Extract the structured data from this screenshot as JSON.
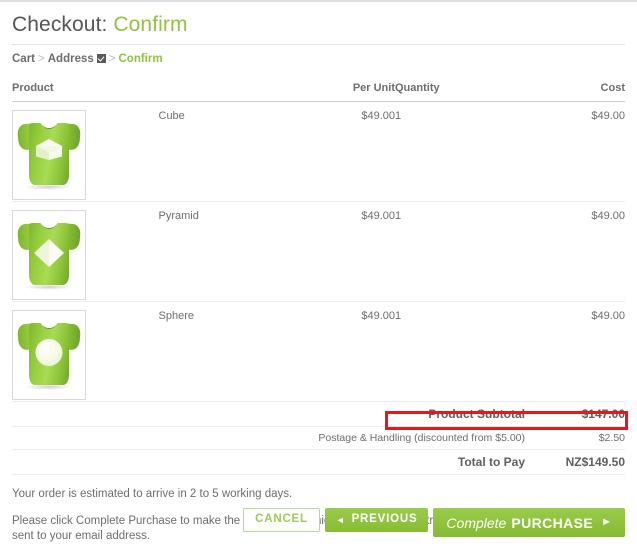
{
  "header": {
    "title_prefix": "Checkout:",
    "title_accent": "Confirm"
  },
  "breadcrumb": {
    "cart": "Cart",
    "address": "Address",
    "confirm": "Confirm",
    "separator": ">",
    "address_checked_icon": "checked-checkbox-icon"
  },
  "table": {
    "headers": {
      "product": "Product",
      "per_unit": "Per Unit",
      "quantity": "Quantity",
      "cost": "Cost"
    },
    "rows": [
      {
        "name": "Cube",
        "per_unit": "$49.00",
        "quantity": "1",
        "cost": "$49.00",
        "thumb_icon": "tshirt-cube-icon"
      },
      {
        "name": "Pyramid",
        "per_unit": "$49.00",
        "quantity": "1",
        "cost": "$49.00",
        "thumb_icon": "tshirt-pyramid-icon"
      },
      {
        "name": "Sphere",
        "per_unit": "$49.00",
        "quantity": "1",
        "cost": "$49.00",
        "thumb_icon": "tshirt-sphere-icon"
      }
    ]
  },
  "totals": {
    "subtotal_label": "Product Subtotal",
    "subtotal_value": "$147.00",
    "postage_label": "Postage & Handling (discounted from $5.00)",
    "postage_value": "$2.50",
    "total_label": "Total to Pay",
    "total_value": "NZ$149.50"
  },
  "notes": {
    "delivery": "Your order is estimated to arrive in 2 to 5 working days.",
    "instructions": "Please click Complete Purchase to make the purchase at which time payment instructions will be both displayed and sent to your email address."
  },
  "buttons": {
    "cancel": "CANCEL",
    "previous": "PREVIOUS",
    "previous_arrow": "◄",
    "purchase_light": "Complete",
    "purchase_bold": "PURCHASE",
    "purchase_arrow": "►"
  },
  "colors": {
    "accent_green": "#8fc53f",
    "button_green": "#93c63e",
    "highlight_red": "#e8161d",
    "text_gray": "#6d6d6d"
  }
}
